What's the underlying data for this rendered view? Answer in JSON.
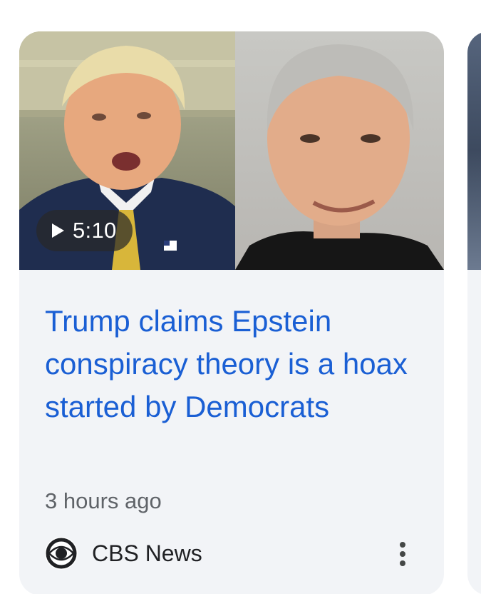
{
  "story": {
    "duration": "5:10",
    "headline": "Trump claims Epstein conspiracy theory is a hoax started by Democrats",
    "timestamp": "3 hours ago",
    "source": "CBS News",
    "headline_color": "#1a5fd4",
    "icons": {
      "play": "play-icon",
      "source_logo": "cbs-eye-logo-icon",
      "more": "more-vertical-icon"
    }
  }
}
